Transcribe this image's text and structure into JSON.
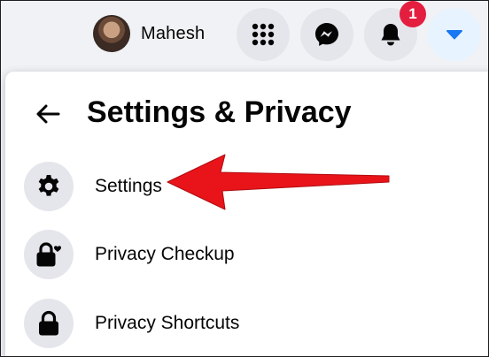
{
  "topbar": {
    "profile_name": "Mahesh",
    "notifications_count": "1",
    "icons": [
      "menu-grid-icon",
      "messenger-icon",
      "bell-icon",
      "caret-down-icon"
    ]
  },
  "panel": {
    "title": "Settings & Privacy",
    "back_icon": "arrow-left-icon",
    "items": [
      {
        "label": "Settings",
        "icon": "gear-icon"
      },
      {
        "label": "Privacy Checkup",
        "icon": "lock-heart-icon"
      },
      {
        "label": "Privacy Shortcuts",
        "icon": "lock-icon"
      }
    ]
  },
  "colors": {
    "background": "#f0f2f5",
    "panel": "#ffffff",
    "icon_circle": "#e4e6eb",
    "active_blue": "#1877f2",
    "active_bg": "#e7f3ff",
    "badge": "#e41e3f",
    "annotation_arrow": "#e8141a"
  }
}
